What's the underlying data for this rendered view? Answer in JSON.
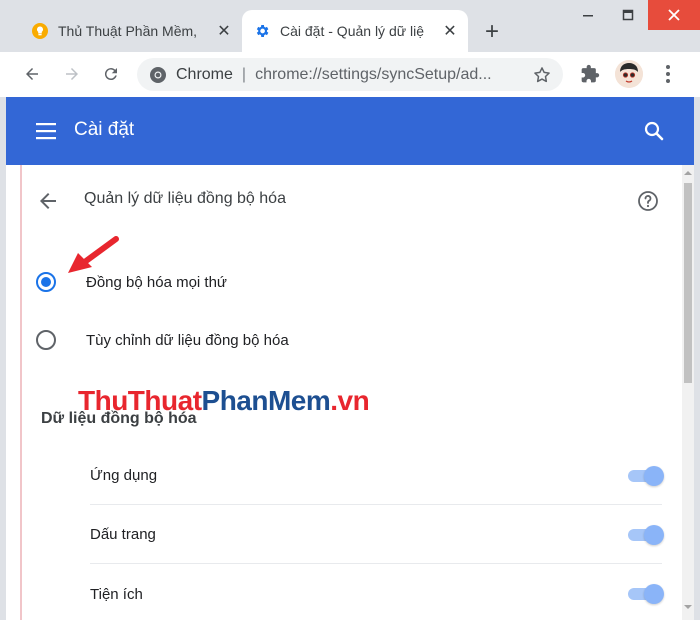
{
  "tabs": [
    {
      "title": "Thủ Thuật Phần Mềm, ",
      "favicon": "lightbulb-icon",
      "active": false
    },
    {
      "title": "Cài đặt - Quản lý dữ liệ",
      "favicon": "gear-icon",
      "active": true
    }
  ],
  "toolbar": {
    "origin": "Chrome",
    "separator": "|",
    "url": "chrome://settings/syncSetup/ad..."
  },
  "header": {
    "title": "Cài đặt"
  },
  "page": {
    "title": "Quản lý dữ liệu đồng bộ hóa",
    "radio_options": [
      {
        "label": "Đồng bộ hóa mọi thứ",
        "checked": true
      },
      {
        "label": "Tùy chỉnh dữ liệu đồng bộ hóa",
        "checked": false
      }
    ],
    "section_title": "Dữ liệu đồng bộ hóa",
    "sync_items": [
      {
        "label": "Ứng dụng",
        "enabled": true
      },
      {
        "label": "Dấu trang",
        "enabled": true
      },
      {
        "label": "Tiện ích",
        "enabled": true
      }
    ]
  },
  "watermark": {
    "part1": "ThuThuat",
    "part2": "PhanMem",
    "part3": ".vn"
  },
  "colors": {
    "accent": "#1a73e8",
    "header_bg": "#3367d6",
    "arrow": "#e8262e"
  }
}
